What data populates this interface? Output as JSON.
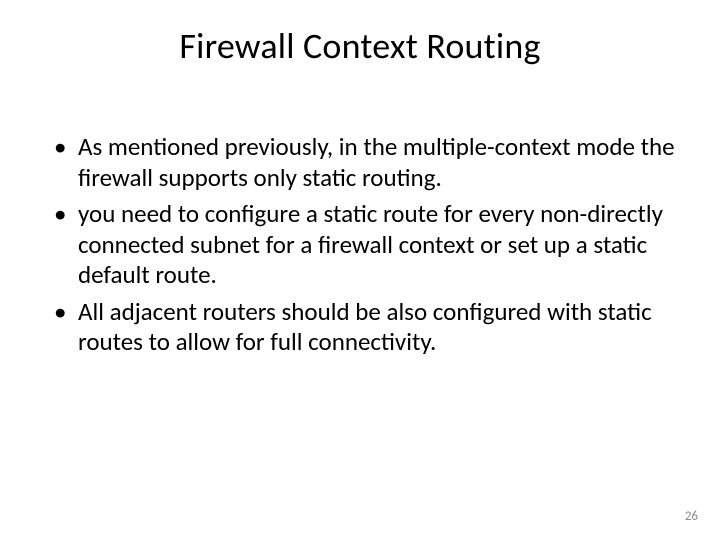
{
  "slide": {
    "title": "Firewall Context Routing",
    "bullets": [
      "As mentioned previously, in the multiple-context mode the firewall supports only static routing.",
      "you need to configure a static route for every non-directly connected subnet for a firewall context or set up a static default route.",
      "All adjacent routers should be also configured with static routes to allow for full connectivity."
    ],
    "page_number": "26"
  }
}
